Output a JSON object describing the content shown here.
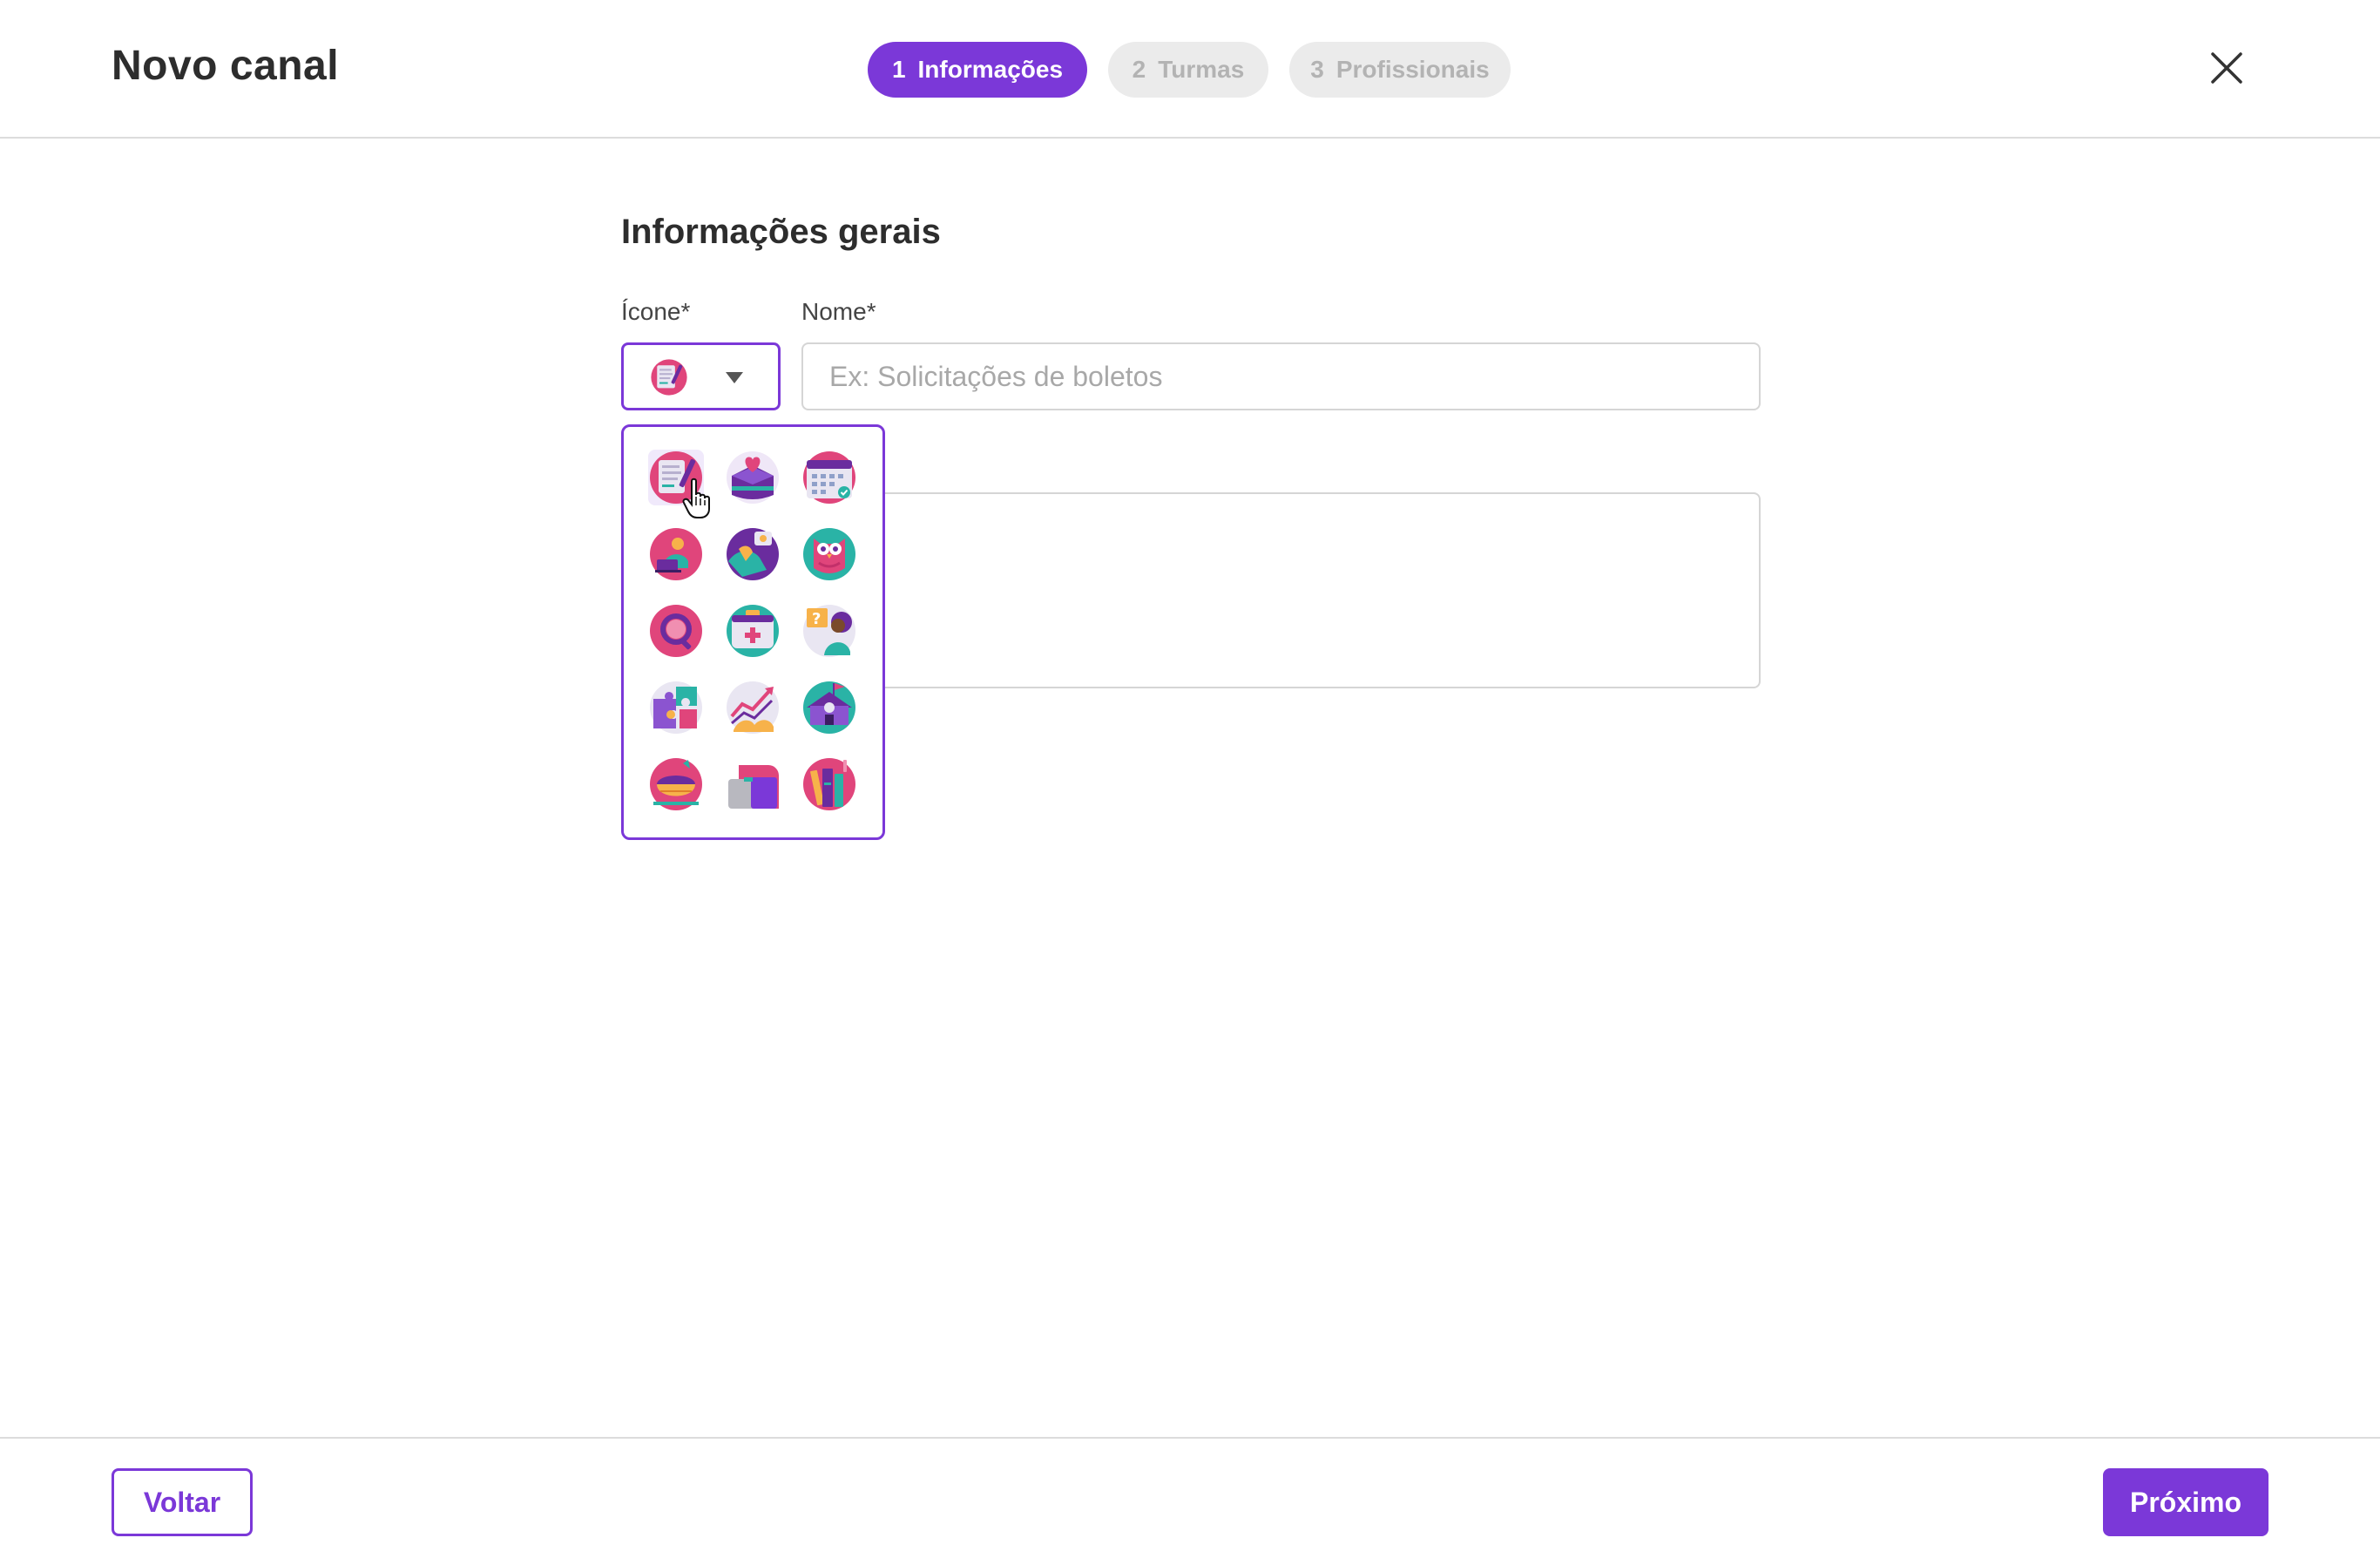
{
  "header": {
    "title": "Novo canal",
    "steps": [
      {
        "num": "1",
        "label": "Informações",
        "state": "active"
      },
      {
        "num": "2",
        "label": "Turmas",
        "state": "inactive"
      },
      {
        "num": "3",
        "label": "Profissionais",
        "state": "inactive"
      }
    ],
    "close_icon": "close-icon"
  },
  "form": {
    "section_title": "Informações gerais",
    "icon_label": "Ícone*",
    "name_label": "Nome*",
    "name_placeholder": "Ex: Solicitações de boletos",
    "name_value": "",
    "selected_icon": "document-pen-icon"
  },
  "icon_picker": {
    "open": true,
    "hovered_index": 0,
    "icons": [
      "document-pen-icon",
      "heart-box-icon",
      "calendar-check-icon",
      "student-laptop-icon",
      "hands-chat-icon",
      "owl-icon",
      "magnifier-icon",
      "medical-kit-icon",
      "question-person-icon",
      "puzzle-icon",
      "growth-chart-icon",
      "school-building-icon",
      "food-bowl-icon",
      "wallet-icon",
      "books-icon"
    ]
  },
  "footer": {
    "back_label": "Voltar",
    "next_label": "Próximo"
  },
  "colors": {
    "accent": "#7b38d8",
    "pink": "#e0457b",
    "teal": "#2ab3a6",
    "purple_dark": "#6a2c9e",
    "orange": "#f7b24a",
    "inactive_step_bg": "#ebebeb",
    "inactive_step_text": "#b3b3b3",
    "border": "#d5d5d5"
  }
}
